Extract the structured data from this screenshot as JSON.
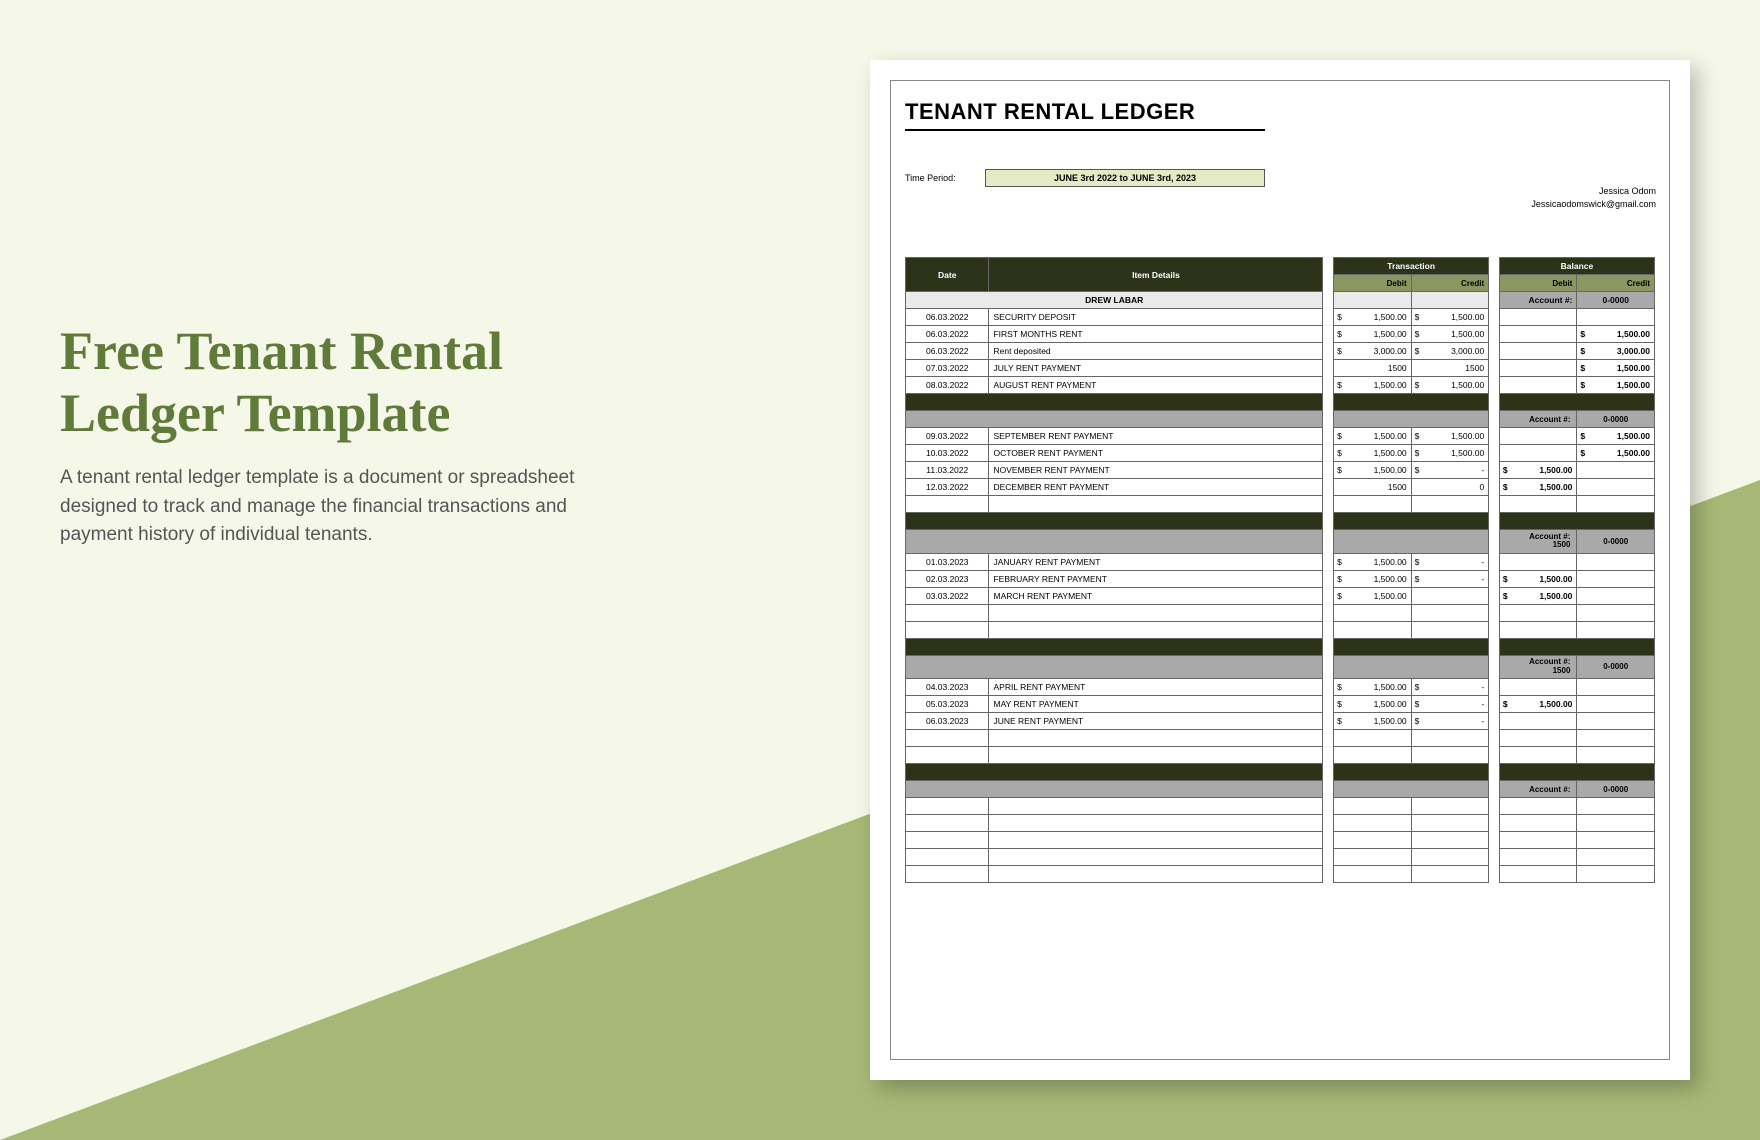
{
  "page": {
    "title": "Free Tenant Rental Ledger Template",
    "description": "A tenant rental ledger template is a document or spreadsheet designed to track and manage the financial transactions and payment history of individual tenants."
  },
  "doc": {
    "title": "TENANT RENTAL LEDGER",
    "time_label": "Time Period:",
    "time_value": "JUNE 3rd 2022 to JUNE 3rd, 2023",
    "contact_name": "Jessica Odom",
    "contact_email": "Jessicaodomswick@gmail.com",
    "headers": {
      "date": "Date",
      "item": "Item Details",
      "transaction": "Transaction",
      "balance": "Balance",
      "debit": "Debit",
      "credit": "Credit",
      "account": "Account #:",
      "account_val": "0-0000"
    },
    "tenant_name": "DREW LABAR",
    "sections": [
      {
        "account": "0-0000",
        "rows": [
          {
            "date": "06.03.2022",
            "item": "SECURITY DEPOSIT",
            "td": "$",
            "tdv": "1,500.00",
            "tc": "$",
            "tcv": "1,500.00",
            "bd": "",
            "bdv": "",
            "bc": "",
            "bcv": ""
          },
          {
            "date": "06.03.2022",
            "item": "FIRST MONTHS RENT",
            "td": "$",
            "tdv": "1,500.00",
            "tc": "$",
            "tcv": "1,500.00",
            "bd": "",
            "bdv": "",
            "bc": "$",
            "bcv": "1,500.00"
          },
          {
            "date": "06.03.2022",
            "item": "Rent deposited",
            "td": "$",
            "tdv": "3,000.00",
            "tc": "$",
            "tcv": "3,000.00",
            "bd": "",
            "bdv": "",
            "bc": "$",
            "bcv": "3,000.00"
          },
          {
            "date": "07.03.2022",
            "item": "JULY RENT PAYMENT",
            "td": "",
            "tdv": "1500",
            "tc": "",
            "tcv": "1500",
            "bd": "",
            "bdv": "",
            "bc": "$",
            "bcv": "1,500.00"
          },
          {
            "date": "08.03.2022",
            "item": "AUGUST RENT PAYMENT",
            "td": "$",
            "tdv": "1,500.00",
            "tc": "$",
            "tcv": "1,500.00",
            "bd": "",
            "bdv": "",
            "bc": "$",
            "bcv": "1,500.00"
          }
        ]
      },
      {
        "account": "0-0000",
        "rows": [
          {
            "date": "09.03.2022",
            "item": "SEPTEMBER RENT PAYMENT",
            "td": "$",
            "tdv": "1,500.00",
            "tc": "$",
            "tcv": "1,500.00",
            "bd": "",
            "bdv": "",
            "bc": "$",
            "bcv": "1,500.00"
          },
          {
            "date": "10.03.2022",
            "item": "OCTOBER RENT PAYMENT",
            "td": "$",
            "tdv": "1,500.00",
            "tc": "$",
            "tcv": "1,500.00",
            "bd": "",
            "bdv": "",
            "bc": "$",
            "bcv": "1,500.00"
          },
          {
            "date": "11.03.2022",
            "item": "NOVEMBER RENT PAYMENT",
            "td": "$",
            "tdv": "1,500.00",
            "tc": "$",
            "tcv": "-",
            "bd": "$",
            "bdv": "1,500.00",
            "bc": "",
            "bcv": ""
          },
          {
            "date": "12.03.2022",
            "item": "DECEMBER RENT PAYMENT",
            "td": "",
            "tdv": "1500",
            "tc": "",
            "tcv": "0",
            "bd": "$",
            "bdv": "1,500.00",
            "bc": "",
            "bcv": ""
          },
          {
            "date": "",
            "item": "",
            "td": "",
            "tdv": "",
            "tc": "",
            "tcv": "",
            "bd": "",
            "bdv": "",
            "bc": "",
            "bcv": ""
          }
        ]
      },
      {
        "account": "0-0000",
        "header_extra": "1500",
        "rows": [
          {
            "date": "01.03.2023",
            "item": "JANUARY RENT PAYMENT",
            "td": "$",
            "tdv": "1,500.00",
            "tc": "$",
            "tcv": "-",
            "bd": "",
            "bdv": "",
            "bc": "",
            "bcv": ""
          },
          {
            "date": "02.03.2023",
            "item": "FEBRUARY RENT PAYMENT",
            "td": "$",
            "tdv": "1,500.00",
            "tc": "$",
            "tcv": "-",
            "bd": "$",
            "bdv": "1,500.00",
            "bc": "",
            "bcv": ""
          },
          {
            "date": "03.03.2022",
            "item": "MARCH RENT PAYMENT",
            "td": "$",
            "tdv": "1,500.00",
            "tc": "",
            "tcv": "",
            "bd": "$",
            "bdv": "1,500.00",
            "bc": "",
            "bcv": ""
          },
          {
            "date": "",
            "item": "",
            "td": "",
            "tdv": "",
            "tc": "",
            "tcv": "",
            "bd": "",
            "bdv": "",
            "bc": "",
            "bcv": ""
          },
          {
            "date": "",
            "item": "",
            "td": "",
            "tdv": "",
            "tc": "",
            "tcv": "",
            "bd": "",
            "bdv": "",
            "bc": "",
            "bcv": ""
          }
        ]
      },
      {
        "account": "0-0000",
        "header_extra": "1500",
        "rows": [
          {
            "date": "04.03.2023",
            "item": "APRIL RENT PAYMENT",
            "td": "$",
            "tdv": "1,500.00",
            "tc": "$",
            "tcv": "-",
            "bd": "",
            "bdv": "",
            "bc": "",
            "bcv": ""
          },
          {
            "date": "05.03.2023",
            "item": "MAY RENT PAYMENT",
            "td": "$",
            "tdv": "1,500.00",
            "tc": "$",
            "tcv": "-",
            "bd": "$",
            "bdv": "1,500.00",
            "bc": "",
            "bcv": ""
          },
          {
            "date": "06.03.2023",
            "item": "JUNE RENT PAYMENT",
            "td": "$",
            "tdv": "1,500.00",
            "tc": "$",
            "tcv": "-",
            "bd": "",
            "bdv": "",
            "bc": "",
            "bcv": ""
          },
          {
            "date": "",
            "item": "",
            "td": "",
            "tdv": "",
            "tc": "",
            "tcv": "",
            "bd": "",
            "bdv": "",
            "bc": "",
            "bcv": ""
          },
          {
            "date": "",
            "item": "",
            "td": "",
            "tdv": "",
            "tc": "",
            "tcv": "",
            "bd": "",
            "bdv": "",
            "bc": "",
            "bcv": ""
          }
        ]
      },
      {
        "account": "0-0000",
        "rows": [
          {
            "date": "",
            "item": "",
            "td": "",
            "tdv": "",
            "tc": "",
            "tcv": "",
            "bd": "",
            "bdv": "",
            "bc": "",
            "bcv": ""
          },
          {
            "date": "",
            "item": "",
            "td": "",
            "tdv": "",
            "tc": "",
            "tcv": "",
            "bd": "",
            "bdv": "",
            "bc": "",
            "bcv": ""
          },
          {
            "date": "",
            "item": "",
            "td": "",
            "tdv": "",
            "tc": "",
            "tcv": "",
            "bd": "",
            "bdv": "",
            "bc": "",
            "bcv": ""
          },
          {
            "date": "",
            "item": "",
            "td": "",
            "tdv": "",
            "tc": "",
            "tcv": "",
            "bd": "",
            "bdv": "",
            "bc": "",
            "bcv": ""
          },
          {
            "date": "",
            "item": "",
            "td": "",
            "tdv": "",
            "tc": "",
            "tcv": "",
            "bd": "",
            "bdv": "",
            "bc": "",
            "bcv": ""
          }
        ]
      }
    ]
  }
}
